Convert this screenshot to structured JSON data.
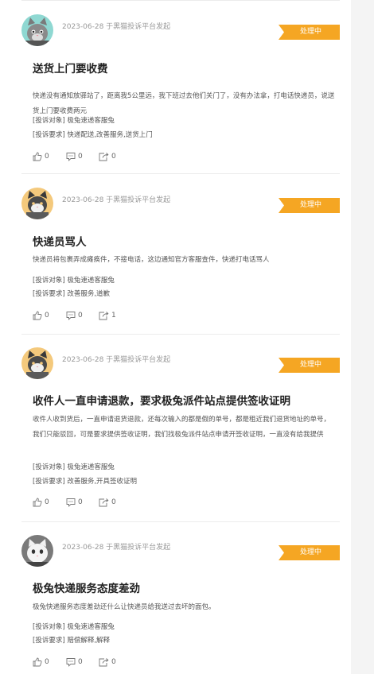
{
  "status_color": "#f5a623",
  "complaints": [
    {
      "avatar": "grey-cat",
      "meta": "2023-06-28 于黑猫投诉平台发起",
      "status": "处理中",
      "title": "送货上门要收费",
      "content": "快递没有通知放驿站了，距离我5公里远，我下班过去他们关门了，没有办法拿，打电话快递员，说送货上门要收费两元",
      "target_label": "[投诉对象]",
      "target_value": "极兔速递客服兔",
      "request_label": "[投诉要求]",
      "request_value": "快递配送,改善服务,送货上门",
      "likes": "0",
      "comments": "0",
      "shares": "0"
    },
    {
      "avatar": "orange-cat",
      "meta": "2023-06-28 于黑猫投诉平台发起",
      "status": "处理中",
      "title": "快递员骂人",
      "content": "快递员将包裹弄成瘫痪件，不接电话，这边通知官方客服查件，快递打电话骂人",
      "target_label": "[投诉对象]",
      "target_value": "极兔速递客服兔",
      "request_label": "[投诉要求]",
      "request_value": "改善服务,道歉",
      "likes": "0",
      "comments": "0",
      "shares": "1"
    },
    {
      "avatar": "orange-cat",
      "meta": "2023-06-28 于黑猫投诉平台发起",
      "status": "处理中",
      "title": "收件人一直申请退款，要求极兔派件站点提供签收证明",
      "content": "收件人收到货后，一直申请退货退款，还每次输入的都是假的单号，都是租近我们退货地址的单号，我们只能驳回，可是要求提供签收证明，我们找极兔派件站点申请开签收证明，一直没有给我提供",
      "target_label": "[投诉对象]",
      "target_value": "极兔速递客服兔",
      "request_label": "[投诉要求]",
      "request_value": "改善服务,开具签收证明",
      "likes": "0",
      "comments": "0",
      "shares": "0"
    },
    {
      "avatar": "white-cat",
      "meta": "2023-06-28 于黑猫投诉平台发起",
      "status": "处理中",
      "title": "极兔快递服务态度差劲",
      "content": "极兔快递服务态度差劲还什么让快递员给我送过去坏的面包。",
      "target_label": "[投诉对象]",
      "target_value": "极兔速递客服兔",
      "request_label": "[投诉要求]",
      "request_value": "赔偿解释,解释",
      "likes": "0",
      "comments": "0",
      "shares": "0"
    }
  ]
}
